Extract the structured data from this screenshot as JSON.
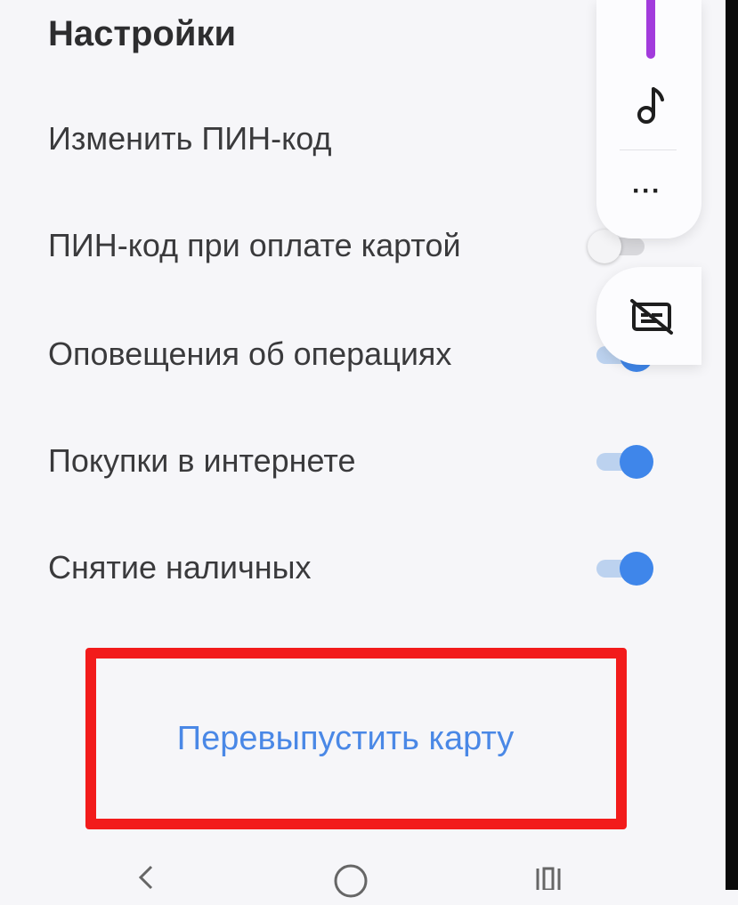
{
  "settings": {
    "title": "Настройки",
    "items": [
      {
        "label": "Изменить ПИН-код",
        "has_toggle": false
      },
      {
        "label": "ПИН-код при оплате картой",
        "has_toggle": true,
        "toggle_on": false
      },
      {
        "label": "Оповещения об операциях",
        "has_toggle": true,
        "toggle_on": true
      },
      {
        "label": "Покупки в интернете",
        "has_toggle": true,
        "toggle_on": true
      },
      {
        "label": "Снятие наличных",
        "has_toggle": true,
        "toggle_on": true
      }
    ],
    "reissue_label": "Перевыпустить карту"
  },
  "floating_panel": {
    "icons": [
      "music-note-icon",
      "more-dots-icon"
    ],
    "caption_icon": "captions-off-icon"
  },
  "navbar": {
    "icons": [
      "back-icon",
      "home-icon",
      "recents-icon"
    ]
  },
  "colors": {
    "background": "#f6f6f9",
    "accent_blue": "#3f86ea",
    "link_blue": "#4a88e6",
    "highlight_red": "#f21b1b",
    "purple_indicator": "#a23bdc"
  }
}
